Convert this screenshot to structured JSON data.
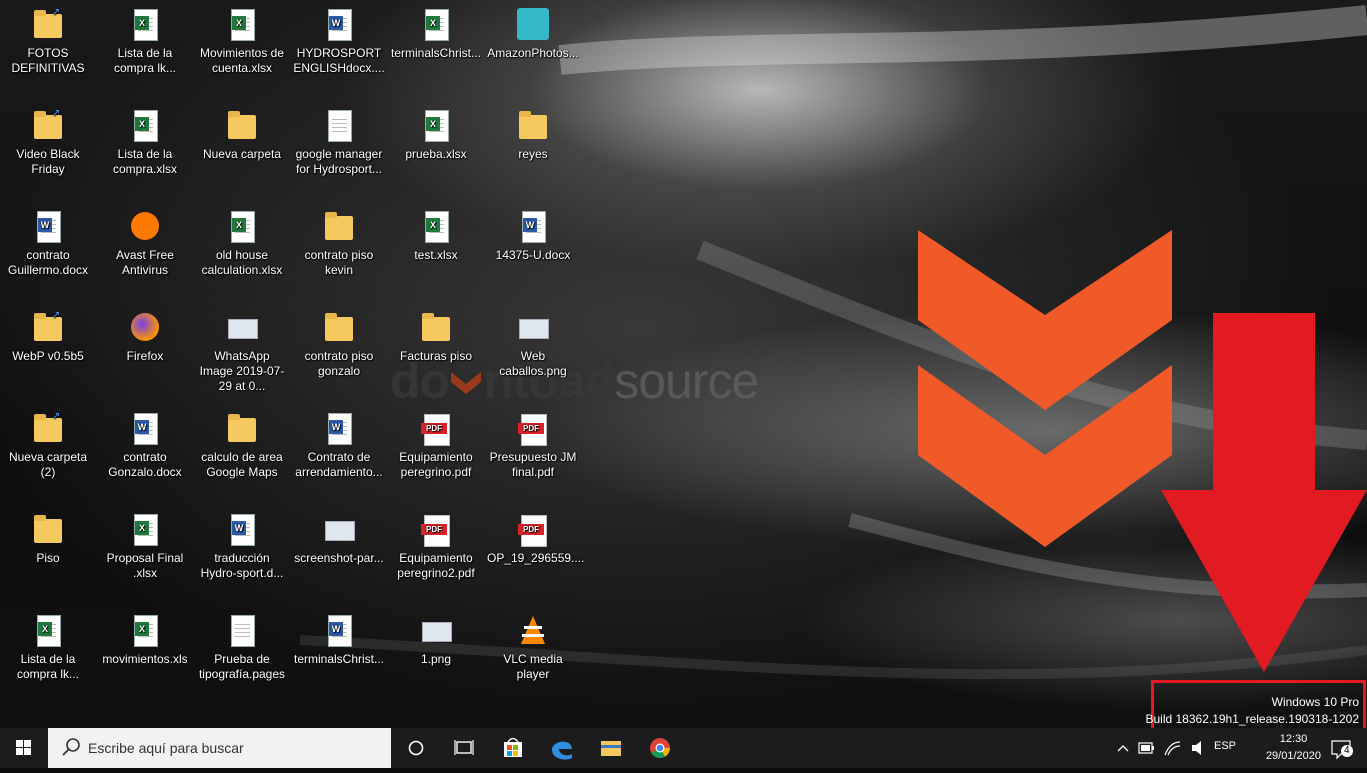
{
  "desktop": {
    "icons": [
      {
        "label": "FOTOS DEFINITIVAS",
        "type": "folder-shortcut-icon"
      },
      {
        "label": "Lista de la compra lk...",
        "type": "excel-file-icon"
      },
      {
        "label": "Movimientos de cuenta.xlsx",
        "type": "excel-file-icon"
      },
      {
        "label": "HYDROSPORT ENGLISHdocx....",
        "type": "word-file-icon"
      },
      {
        "label": "terminalsChrist...",
        "type": "excel-file-icon"
      },
      {
        "label": "AmazonPhotos...",
        "type": "amazon-photos-icon"
      },
      {
        "label": "Video Black Friday",
        "type": "folder-shortcut-icon"
      },
      {
        "label": "Lista de la compra.xlsx",
        "type": "excel-file-icon"
      },
      {
        "label": "Nueva carpeta",
        "type": "folder-icon"
      },
      {
        "label": "google manager for Hydrosport...",
        "type": "text-file-icon"
      },
      {
        "label": "prueba.xlsx",
        "type": "excel-file-icon"
      },
      {
        "label": "reyes",
        "type": "folder-icon"
      },
      {
        "label": "contrato Guillermo.docx",
        "type": "word-file-icon"
      },
      {
        "label": "Avast Free Antivirus",
        "type": "avast-icon"
      },
      {
        "label": "old house calculation.xlsx",
        "type": "excel-file-icon"
      },
      {
        "label": "contrato piso kevin",
        "type": "folder-icon"
      },
      {
        "label": "test.xlsx",
        "type": "excel-file-icon"
      },
      {
        "label": "14375-U.docx",
        "type": "word-file-icon"
      },
      {
        "label": "WebP v0.5b5",
        "type": "folder-shortcut-icon"
      },
      {
        "label": "Firefox",
        "type": "firefox-icon"
      },
      {
        "label": "WhatsApp Image 2019-07-29 at 0...",
        "type": "image-file-icon"
      },
      {
        "label": "contrato piso gonzalo",
        "type": "folder-icon"
      },
      {
        "label": "Facturas piso",
        "type": "folder-icon"
      },
      {
        "label": "Web caballos.png",
        "type": "image-file-icon"
      },
      {
        "label": "Nueva carpeta (2)",
        "type": "folder-shortcut-icon"
      },
      {
        "label": "contrato Gonzalo.docx",
        "type": "word-file-icon"
      },
      {
        "label": "calculo de area Google Maps",
        "type": "folder-icon"
      },
      {
        "label": "Contrato de arrendamiento...",
        "type": "word-file-icon"
      },
      {
        "label": "Equipamiento peregrino.pdf",
        "type": "pdf-file-icon"
      },
      {
        "label": "Presupuesto JM final.pdf",
        "type": "pdf-file-icon"
      },
      {
        "label": "Piso",
        "type": "folder-icon"
      },
      {
        "label": "Proposal Final .xlsx",
        "type": "excel-file-icon"
      },
      {
        "label": "traducción Hydro-sport.d...",
        "type": "word-file-icon"
      },
      {
        "label": "screenshot-par...",
        "type": "image-file-icon"
      },
      {
        "label": "Equipamiento peregrino2.pdf",
        "type": "pdf-file-icon"
      },
      {
        "label": "OP_19_296559....",
        "type": "pdf-file-icon"
      },
      {
        "label": "Lista de la compra lk...",
        "type": "excel-file-icon"
      },
      {
        "label": "movimientos.xls",
        "type": "excel-file-icon"
      },
      {
        "label": "Prueba de tipografía.pages",
        "type": "text-file-icon"
      },
      {
        "label": "terminalsChrist...",
        "type": "word-file-icon"
      },
      {
        "label": "1.png",
        "type": "image-file-icon"
      },
      {
        "label": "VLC media player",
        "type": "vlc-icon"
      }
    ]
  },
  "watermark": {
    "part1": "do",
    "part2": "ntoad",
    "part3": "source"
  },
  "windows_info": {
    "edition": "Windows 10 Pro",
    "build": "Build 18362.19h1_release.190318-1202"
  },
  "taskbar": {
    "search_placeholder": "Escribe aquí para buscar",
    "language": "ESP",
    "time": "12:30",
    "date": "29/01/2020",
    "notification_count": "4"
  },
  "colors": {
    "accent_orange": "#f05a28",
    "annotation_red": "#e21a22",
    "taskbar": "#1c1c1c"
  }
}
